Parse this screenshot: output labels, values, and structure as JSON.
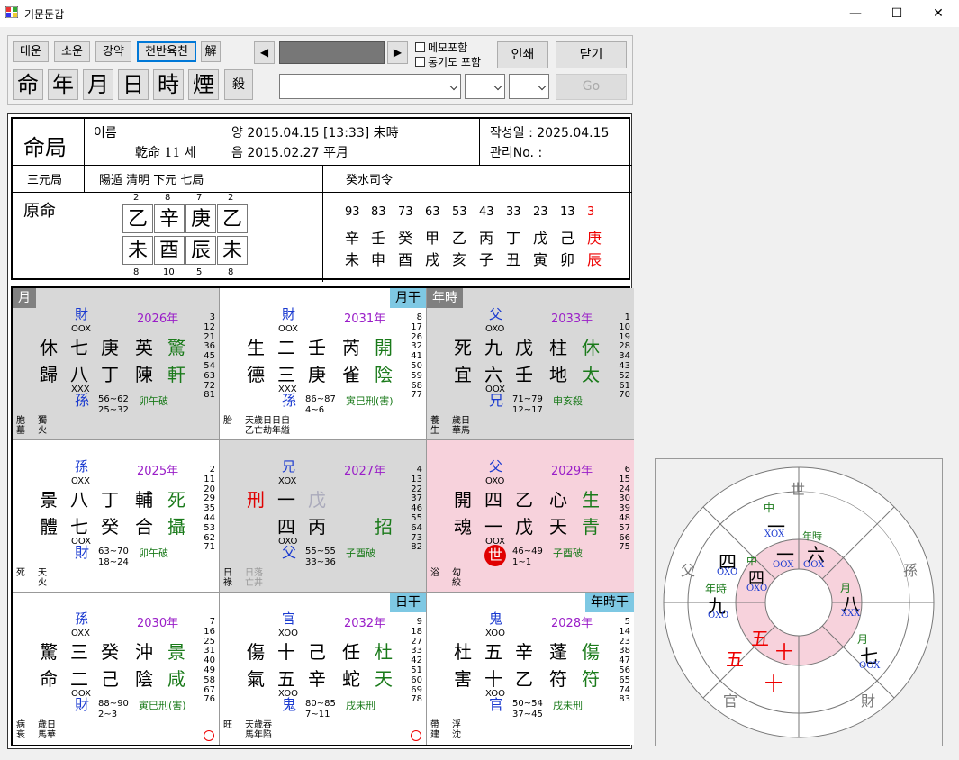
{
  "window": {
    "title": "기문둔갑",
    "min": "—",
    "max": "☐",
    "close": "✕"
  },
  "toolbar": {
    "row1": [
      "대운",
      "소운",
      "강약",
      "천반육친",
      "解"
    ],
    "row2": [
      "命",
      "年",
      "月",
      "日",
      "時",
      "煙",
      "殺"
    ],
    "prev": "◀",
    "next": "▶",
    "chk_memo": "메모포함",
    "chk_tongi": "통기도 포함",
    "print": "인쇄",
    "close": "닫기",
    "go": "Go"
  },
  "header": {
    "title": "命局",
    "name_label": "이름",
    "gender_age": "乾命 11 세",
    "solar": "양 2015.04.15 [13:33] 未時",
    "lunar": "음 2015.02.27 平月",
    "written": "작성일 : 2025.04.15",
    "admin": "관리No. :",
    "samwon": "三元局",
    "ju": "陽遁 清明 下元 七局",
    "saryeong": "癸水司令",
    "wonmyeong": "原命",
    "saju_top_nums": [
      "2",
      "8",
      "7",
      "2"
    ],
    "saju_stems": [
      "乙",
      "辛",
      "庚",
      "乙"
    ],
    "saju_branches": [
      "未",
      "酉",
      "辰",
      "未"
    ],
    "saju_bot_nums": [
      "8",
      "10",
      "5",
      "8"
    ],
    "daeun_ages": [
      "93",
      "83",
      "73",
      "63",
      "53",
      "43",
      "33",
      "23",
      "13",
      "3"
    ],
    "daeun_stems": [
      "辛",
      "壬",
      "癸",
      "甲",
      "乙",
      "丙",
      "丁",
      "戊",
      "己",
      "庚"
    ],
    "daeun_branches": [
      "未",
      "申",
      "酉",
      "戌",
      "亥",
      "子",
      "丑",
      "寅",
      "卯",
      "辰"
    ]
  },
  "palaces": [
    {
      "tag": "月",
      "tag2": "",
      "yuk": "財",
      "yuk_pat": "OOX",
      "year": "2026年",
      "g1": "休",
      "g2": "七",
      "g3": "庚",
      "g4": "英",
      "g5": "驚",
      "g6": "歸",
      "g7": "八",
      "g8": "丁",
      "g9": "陳",
      "g10": "軒",
      "low_pat": "XXX",
      "low_yuk": "孫",
      "range": "56~62",
      "range2": "25~32",
      "note": "卯午破",
      "bl1": "胞",
      "bl2": "墓",
      "bl3": "獨",
      "bl4": "火",
      "nums": [
        "3",
        "12",
        "21",
        "36",
        "45",
        "54",
        "63",
        "72",
        "81"
      ]
    },
    {
      "tag": "",
      "tag2": "月干",
      "yuk": "財",
      "yuk_pat": "OOX",
      "year": "2031年",
      "g1": "生",
      "g2": "二",
      "g3": "壬",
      "g4": "芮",
      "g5": "開",
      "g6": "德",
      "g7": "三",
      "g8": "庚",
      "g9": "雀",
      "g10": "陰",
      "low_pat": "XXX",
      "low_yuk": "孫",
      "range": "86~87",
      "range2": "4~6",
      "note": "寅巳刑(害)",
      "bl1": "胎",
      "bl2": "",
      "bl3": "天歲日日自",
      "bl4": "乙亡劫年縊",
      "nums": [
        "8",
        "17",
        "26",
        "32",
        "41",
        "50",
        "59",
        "68",
        "77"
      ]
    },
    {
      "tag": "年時",
      "tag2": "",
      "yuk": "父",
      "yuk_pat": "OXO",
      "year": "2033年",
      "g1": "死",
      "g2": "九",
      "g3": "戊",
      "g4": "柱",
      "g5": "休",
      "g6": "宜",
      "g7": "六",
      "g8": "壬",
      "g9": "地",
      "g10": "太",
      "low_pat": "OOX",
      "low_yuk": "兄",
      "range": "71~79",
      "range2": "12~17",
      "note": "申亥殺",
      "bl1": "養",
      "bl2": "生",
      "bl3": "歲日",
      "bl4": "華馬",
      "nums": [
        "1",
        "10",
        "19",
        "28",
        "34",
        "43",
        "52",
        "61",
        "70"
      ]
    },
    {
      "tag": "",
      "tag2": "",
      "yuk": "孫",
      "yuk_pat": "OXX",
      "year": "2025年",
      "g1": "景",
      "g2": "八",
      "g3": "丁",
      "g4": "輔",
      "g5": "死",
      "g6": "體",
      "g7": "七",
      "g8": "癸",
      "g9": "合",
      "g10": "攝",
      "low_pat": "OOX",
      "low_yuk": "財",
      "range": "63~70",
      "range2": "18~24",
      "note": "卯午破",
      "bl1": "死",
      "bl2": "",
      "bl3": "天",
      "bl4": "火",
      "nums": [
        "2",
        "11",
        "20",
        "29",
        "35",
        "44",
        "53",
        "62",
        "71"
      ]
    },
    {
      "tag": "",
      "tag2": "",
      "yuk": "兄",
      "yuk_pat": "XOX",
      "year": "2027年",
      "g1": "刑",
      "g2": "一",
      "g3": "戊",
      "g4": "",
      "g5": "",
      "g6": "",
      "g7": "四",
      "g8": "丙",
      "g9": "",
      "g10": "招",
      "low_pat": "OXO",
      "low_yuk": "父",
      "range": "55~55",
      "range2": "33~36",
      "note": "子酉破",
      "bl1": "日",
      "bl2": "祿",
      "bl3": "日落",
      "bl4": "亡井",
      "nums": [
        "4",
        "13",
        "22",
        "37",
        "46",
        "55",
        "64",
        "73",
        "82"
      ]
    },
    {
      "tag": "",
      "tag2": "",
      "yuk": "父",
      "yuk_pat": "OXO",
      "year": "2029年",
      "g1": "開",
      "g2": "四",
      "g3": "乙",
      "g4": "心",
      "g5": "生",
      "g6": "魂",
      "g7": "一",
      "g8": "戊",
      "g9": "天",
      "g10": "青",
      "low_pat": "OOX",
      "low_yuk": "世",
      "range": "46~49",
      "range2": "1~1",
      "note": "子酉破",
      "bl1": "浴",
      "bl2": "",
      "bl3": "勾",
      "bl4": "絞",
      "nums": [
        "6",
        "15",
        "24",
        "30",
        "39",
        "48",
        "57",
        "66",
        "75"
      ]
    },
    {
      "tag": "",
      "tag2": "",
      "yuk": "孫",
      "yuk_pat": "OXX",
      "year": "2030年",
      "g1": "驚",
      "g2": "三",
      "g3": "癸",
      "g4": "沖",
      "g5": "景",
      "g6": "命",
      "g7": "二",
      "g8": "己",
      "g9": "陰",
      "g10": "咸",
      "low_pat": "OOX",
      "low_yuk": "財",
      "range": "88~90",
      "range2": "2~3",
      "note": "寅巳刑(害)",
      "bl1": "病",
      "bl2": "衰",
      "bl3": "歲日",
      "bl4": "馬華",
      "nums": [
        "7",
        "16",
        "25",
        "31",
        "40",
        "49",
        "58",
        "67",
        "76"
      ]
    },
    {
      "tag": "",
      "tag2": "日干",
      "yuk": "官",
      "yuk_pat": "XOO",
      "year": "2032年",
      "g1": "傷",
      "g2": "十",
      "g3": "己",
      "g4": "任",
      "g5": "杜",
      "g6": "氣",
      "g7": "五",
      "g8": "辛",
      "g9": "蛇",
      "g10": "天",
      "low_pat": "XOO",
      "low_yuk": "鬼",
      "range": "80~85",
      "range2": "7~11",
      "note": "戌未刑",
      "bl1": "旺",
      "bl2": "",
      "bl3": "天歲吞",
      "bl4": "馬年陷",
      "nums": [
        "9",
        "18",
        "27",
        "33",
        "42",
        "51",
        "60",
        "69",
        "78"
      ]
    },
    {
      "tag": "",
      "tag2": "年時干",
      "yuk": "鬼",
      "yuk_pat": "XOO",
      "year": "2028年",
      "g1": "杜",
      "g2": "五",
      "g3": "辛",
      "g4": "蓬",
      "g5": "傷",
      "g6": "害",
      "g7": "十",
      "g8": "乙",
      "g9": "符",
      "g10": "符",
      "low_pat": "XOO",
      "low_yuk": "官",
      "range": "50~54",
      "range2": "37~45",
      "note": "戌未刑",
      "bl1": "帶",
      "bl2": "建",
      "bl3": "浮",
      "bl4": "沈",
      "nums": [
        "5",
        "14",
        "23",
        "38",
        "47",
        "56",
        "65",
        "74",
        "83"
      ]
    }
  ],
  "wheel": {
    "outer": [
      "世",
      "孫",
      "財",
      "官",
      "父"
    ],
    "marks": [
      "中",
      "一",
      "XOX",
      "年時",
      "一",
      "六",
      "OOX",
      "OOX",
      "四",
      "OXO",
      "中",
      "四",
      "OXO",
      "年時",
      "九",
      "OXO",
      "月",
      "八",
      "XXX",
      "五",
      "十",
      "五",
      "十",
      "月",
      "七",
      "OOX"
    ]
  },
  "colors": {
    "gray": "#d8d8d8",
    "pink": "#f7d2dc",
    "blue_tag": "#7ec8e3",
    "tag_dark": "#808080",
    "green": "#1a7a1a",
    "purple": "#9a1ec8",
    "blue": "#1a3ad0",
    "red": "#e00000"
  }
}
